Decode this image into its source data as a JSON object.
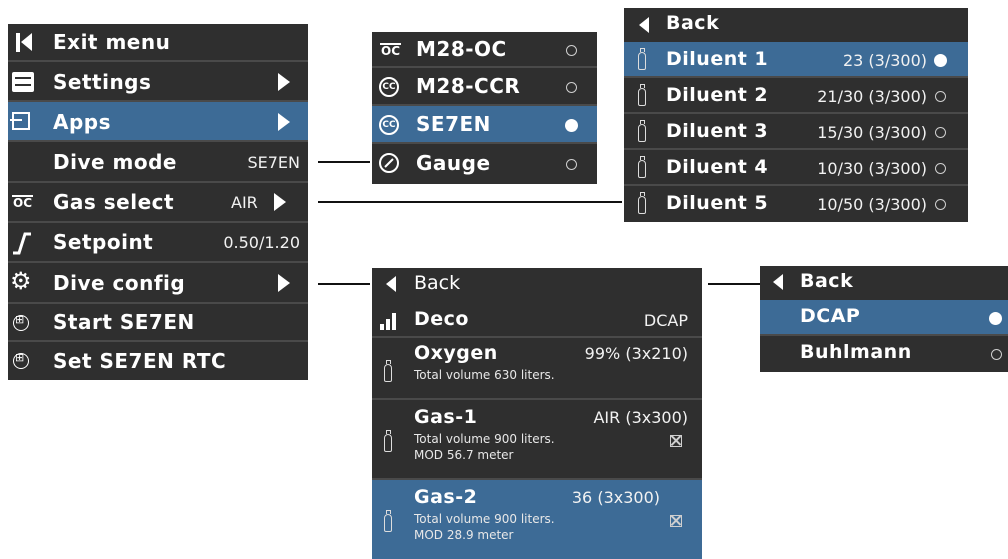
{
  "main_menu": {
    "items": [
      {
        "label": "Exit menu",
        "value": "",
        "icon": "exit-icon",
        "arrow": false,
        "selected": false
      },
      {
        "label": "Settings",
        "value": "",
        "icon": "settings-icon",
        "arrow": true,
        "selected": false
      },
      {
        "label": "Apps",
        "value": "",
        "icon": "apps-icon",
        "arrow": true,
        "selected": true
      },
      {
        "label": "Dive mode",
        "value": "SE7EN",
        "icon": "",
        "arrow": false,
        "selected": false
      },
      {
        "label": "Gas select",
        "value": "AIR",
        "icon": "oc-icon",
        "arrow": true,
        "selected": false
      },
      {
        "label": "Setpoint",
        "value": "0.50/1.20",
        "icon": "setpoint-icon",
        "arrow": false,
        "selected": false
      },
      {
        "label": "Dive config",
        "value": "",
        "icon": "gear-icon",
        "arrow": true,
        "selected": false
      },
      {
        "label": "Start SE7EN",
        "value": "",
        "icon": "bubble-icon",
        "arrow": false,
        "selected": false
      },
      {
        "label": "Set SE7EN RTC",
        "value": "",
        "icon": "bubble-icon",
        "arrow": false,
        "selected": false
      }
    ]
  },
  "dive_mode_menu": {
    "items": [
      {
        "label": "M28-OC",
        "icon": "oc-icon",
        "selected": false
      },
      {
        "label": "M28-CCR",
        "icon": "cc-icon",
        "selected": false
      },
      {
        "label": "SE7EN",
        "icon": "cc-icon",
        "selected": true
      },
      {
        "label": "Gauge",
        "icon": "gauge-icon",
        "selected": false
      }
    ]
  },
  "diluent_menu": {
    "back_label": "Back",
    "items": [
      {
        "label": "Diluent 1",
        "value": "23 (3/300)",
        "selected": true
      },
      {
        "label": "Diluent 2",
        "value": "21/30 (3/300)",
        "selected": false
      },
      {
        "label": "Diluent 3",
        "value": "15/30 (3/300)",
        "selected": false
      },
      {
        "label": "Diluent 4",
        "value": "10/30 (3/300)",
        "selected": false
      },
      {
        "label": "Diluent 5",
        "value": "10/50 (3/300)",
        "selected": false
      }
    ]
  },
  "dive_config_menu": {
    "back_label": "Back",
    "deco": {
      "label": "Deco",
      "value": "DCAP"
    },
    "gases": [
      {
        "label": "Oxygen",
        "value": "99% (3x210)",
        "line1": "Total volume 630 liters.",
        "line2": "",
        "selected": false
      },
      {
        "label": "Gas-1",
        "value": "AIR (3x300)",
        "line1": "Total volume 900 liters.",
        "line2": "MOD 56.7 meter",
        "selected": false
      },
      {
        "label": "Gas-2",
        "value": "36 (3x300)",
        "line1": "Total volume 900 liters.",
        "line2": "MOD 28.9 meter",
        "selected": true
      }
    ]
  },
  "deco_menu": {
    "back_label": "Back",
    "items": [
      {
        "label": "DCAP",
        "selected": true
      },
      {
        "label": "Buhlmann",
        "selected": false
      }
    ]
  },
  "colors": {
    "panel": "#2f2f2f",
    "selected": "#3d6b96",
    "divider": "#4a4a4a"
  }
}
